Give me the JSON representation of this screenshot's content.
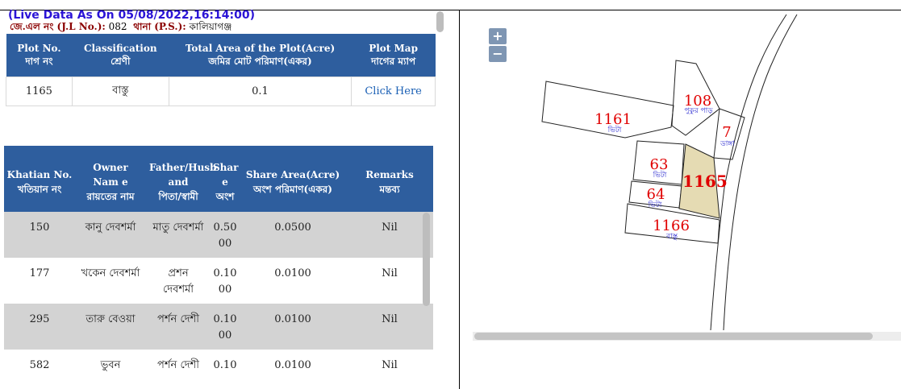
{
  "header": {
    "live_data": "(Live Data As On 05/08/2022,16:14:00)",
    "jl_label": "জে.এল নং (J.L No.):",
    "jl_value": "082",
    "ps_label": "থানা (P.S.):",
    "ps_value": "কালিয়াগঞ্জ"
  },
  "plot_table": {
    "headers": [
      {
        "en": "Plot No.",
        "bn": "দাগ নং"
      },
      {
        "en": "Classification",
        "bn": "শ্রেণী"
      },
      {
        "en": "Total Area of the Plot(Acre)",
        "bn": "জমির মোট পরিমাণ(একর)"
      },
      {
        "en": "Plot Map",
        "bn": "দাগের ম্যাপ"
      }
    ],
    "row": {
      "plot_no": "1165",
      "classification": "বাস্তু",
      "area": "0.1",
      "map_link": "Click Here"
    }
  },
  "khatian_table": {
    "headers": [
      {
        "en": "Khatian No.",
        "bn": "খতিয়ান নং"
      },
      {
        "en": "Owner Nam e",
        "bn": "রায়তের নাম"
      },
      {
        "en": "Father/Husb and",
        "bn": "পিতা/স্বামী"
      },
      {
        "en": "Shar e",
        "bn": "অংশ"
      },
      {
        "en": "Share Area(Acre)",
        "bn": "অংশ পরিমাণ(একর)"
      },
      {
        "en": "Remarks",
        "bn": "মন্তব্য"
      }
    ],
    "rows": [
      {
        "khatian": "150",
        "owner": "কানু দেবশর্মা",
        "father": "মাতু দেবশর্মা",
        "share": "0.50 00",
        "share_area": "0.0500",
        "remarks": "Nil"
      },
      {
        "khatian": "177",
        "owner": "খকেন দেবশর্মা",
        "father": "প্রশন দেবশর্মা",
        "share": "0.10 00",
        "share_area": "0.0100",
        "remarks": "Nil"
      },
      {
        "khatian": "295",
        "owner": "তারু বেওয়া",
        "father": "পর্শন দেশী",
        "share": "0.10 00",
        "share_area": "0.0100",
        "remarks": "Nil"
      },
      {
        "khatian": "582",
        "owner": "ভুবন",
        "father": "পর্শন দেশী",
        "share": "0.10",
        "share_area": "0.0100",
        "remarks": "Nil"
      }
    ]
  },
  "map": {
    "zoom_in": "+",
    "zoom_out": "−",
    "highlight_color": "#e5dbb3",
    "plots": [
      {
        "num": "1161",
        "class": "ভিটা"
      },
      {
        "num": "108",
        "class": "পুকুর পাড়"
      },
      {
        "num": "7",
        "class": "ডাঙ্গা"
      },
      {
        "num": "63",
        "class": "ভিটা"
      },
      {
        "num": "1165",
        "class": ""
      },
      {
        "num": "64",
        "class": "ভিটা"
      },
      {
        "num": "1166",
        "class": "বাস্তু"
      }
    ]
  }
}
